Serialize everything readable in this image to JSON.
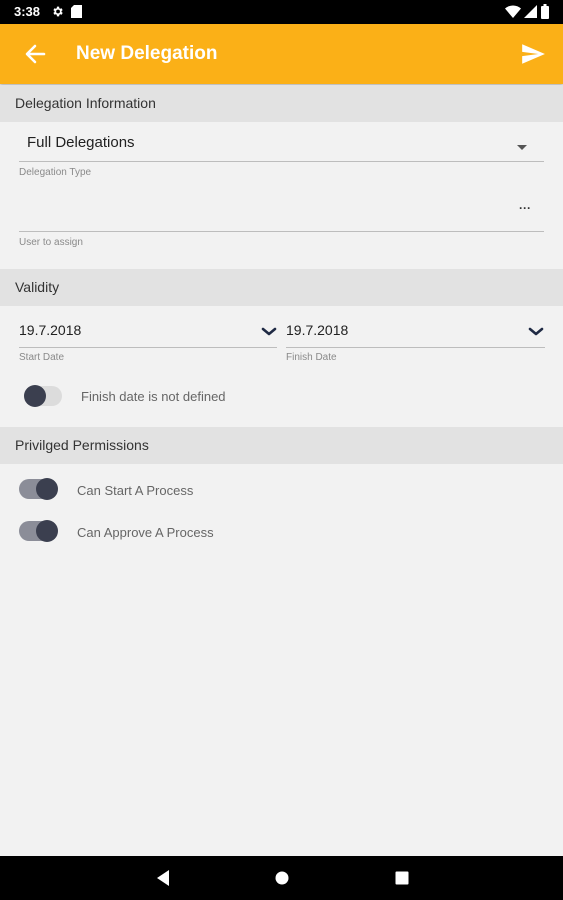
{
  "status_bar": {
    "time": "3:38",
    "icons": [
      "gear-icon",
      "sim-card-icon",
      "wifi-icon",
      "signal-icon",
      "battery-icon"
    ]
  },
  "app_bar": {
    "title": "New Delegation",
    "back_icon": "arrow-back-icon",
    "send_icon": "send-icon",
    "color": "#fbb017"
  },
  "delegation_info": {
    "header": "Delegation Information",
    "delegation_type_value": "Full Delegations",
    "delegation_type_caption": "Delegation Type",
    "user_value": "",
    "user_more": "···",
    "user_caption": "User to assign"
  },
  "validity": {
    "header": "Validity",
    "start_date_value": "19.7.2018",
    "start_date_caption": "Start Date",
    "finish_date_value": "19.7.2018",
    "finish_date_caption": "Finish Date",
    "finish_undefined_label": "Finish date is not defined",
    "finish_undefined_on": false
  },
  "permissions": {
    "header": "Privilged Permissions",
    "can_start_label": "Can Start A Process",
    "can_start_on": true,
    "can_approve_label": "Can Approve A Process",
    "can_approve_on": true
  },
  "nav_bar": {
    "icons": [
      "back-triangle-icon",
      "home-circle-icon",
      "recents-square-icon"
    ]
  }
}
